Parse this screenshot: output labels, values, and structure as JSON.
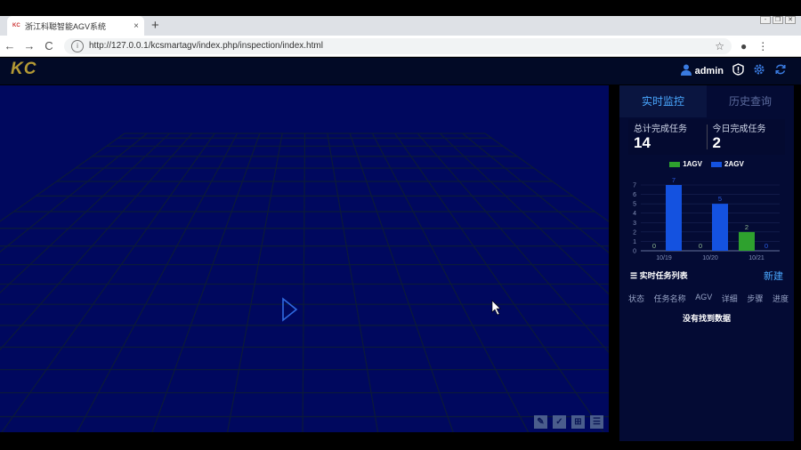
{
  "browser": {
    "tab_favicon": "KC",
    "tab_title": "浙江科聪智能AGV系统",
    "tab_close": "×",
    "new_tab": "+",
    "back": "←",
    "forward": "→",
    "reload": "C",
    "url": "http://127.0.0.1/kcsmartagv/index.php/inspection/index.html",
    "star": "☆",
    "info": "i",
    "profile": "●",
    "menu": "⋮"
  },
  "header": {
    "logo": "KC",
    "username": "admin"
  },
  "panel": {
    "tab_live": "实时监控",
    "tab_history": "历史查询",
    "total_label": "总计完成任务",
    "total_value": "14",
    "today_label": "今日完成任务",
    "today_value": "2",
    "list_title": "实时任务列表",
    "new_button": "新建",
    "columns": [
      "状态",
      "任务名称",
      "AGV",
      "详细",
      "步骤",
      "进度"
    ],
    "no_data": "没有找到数据"
  },
  "colors": {
    "series1": "#2ea12e",
    "series2": "#1452e0"
  },
  "chart_data": {
    "type": "bar",
    "categories": [
      "10/19",
      "10/20",
      "10/21"
    ],
    "series": [
      {
        "name": "1AGV",
        "values": [
          0,
          0,
          2
        ]
      },
      {
        "name": "2AGV",
        "values": [
          7,
          5,
          0
        ]
      }
    ],
    "ylim": [
      0,
      7
    ],
    "yticks": [
      0,
      1,
      2,
      3,
      4,
      5,
      6,
      7
    ],
    "legend": "top"
  }
}
